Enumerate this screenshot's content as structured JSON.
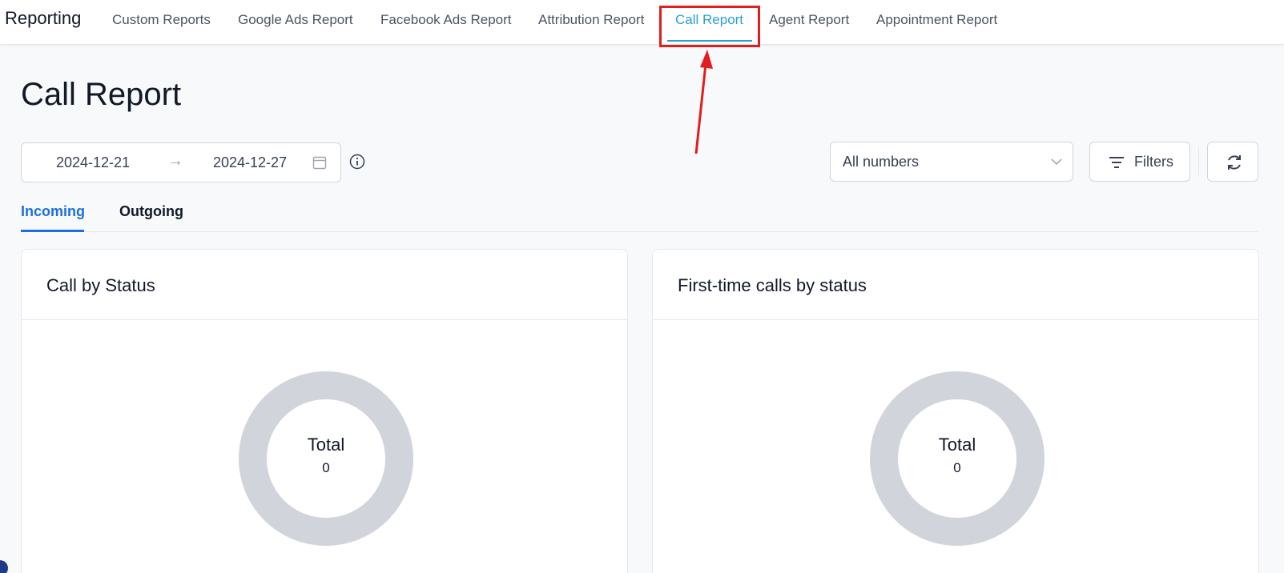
{
  "app": {
    "brand": "Reporting"
  },
  "nav": {
    "tabs": [
      {
        "label": "Custom Reports"
      },
      {
        "label": "Google Ads Report"
      },
      {
        "label": "Facebook Ads Report"
      },
      {
        "label": "Attribution Report"
      },
      {
        "label": "Call Report"
      },
      {
        "label": "Agent Report"
      },
      {
        "label": "Appointment Report"
      }
    ],
    "active_tab": "Call Report"
  },
  "page": {
    "title": "Call Report"
  },
  "date_range": {
    "start": "2024-12-21",
    "end": "2024-12-27"
  },
  "numbers_select": {
    "value": "All numbers"
  },
  "filters": {
    "label": "Filters"
  },
  "subtabs": [
    {
      "label": "Incoming"
    },
    {
      "label": "Outgoing"
    }
  ],
  "cards": [
    {
      "title": "Call by Status",
      "total_label": "Total",
      "total_value": "0"
    },
    {
      "title": "First-time calls by status",
      "total_label": "Total",
      "total_value": "0"
    }
  ],
  "colors": {
    "active_nav": "#2b9fd8",
    "active_subtab": "#1d6fe0",
    "annotation": "#e11d1d",
    "donut_empty": "#d1d5db"
  }
}
